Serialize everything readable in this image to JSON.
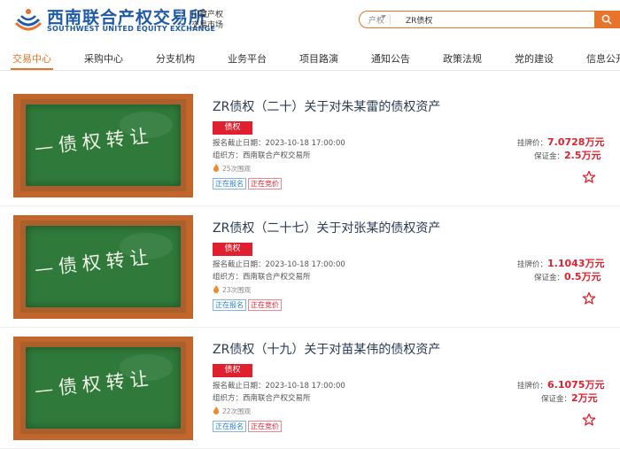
{
  "header": {
    "brand_cn": "西南联合产权交易所",
    "brand_en": "SOUTHWEST UNITED EQUITY EXCHANGE",
    "sub_brand_line1": "川藏产权",
    "sub_brand_line2": "交易市场"
  },
  "search": {
    "category": "产权",
    "value": "ZR债权"
  },
  "nav": {
    "items": [
      "交易中心",
      "采购中心",
      "分支机构",
      "业务平台",
      "项目路演",
      "通知公告",
      "政策法规",
      "党的建设",
      "信息公开"
    ],
    "active_index": 0
  },
  "listings": [
    {
      "thumbnail_text": "—债权转让",
      "title": "ZR债权（二十）关于对朱某雷的债权资产",
      "type": "债权",
      "deadline": "报名截止日期：2023-10-18 17:00:00",
      "organizer": "组织方：西南联合产权交易所",
      "views": "25次围观",
      "status_registering": "正在报名",
      "status_bidding": "正在竞价",
      "listing_price_label": "挂牌价：",
      "listing_price": "7.0728万元",
      "deposit_label": "保证金：",
      "deposit": "2.5万元"
    },
    {
      "thumbnail_text": "—债权转让",
      "title": "ZR债权（二十七）关于对张某的债权资产",
      "type": "债权",
      "deadline": "报名截止日期：2023-10-18 17:00:00",
      "organizer": "组织方：西南联合产权交易所",
      "views": "23次围观",
      "status_registering": "正在报名",
      "status_bidding": "正在竞价",
      "listing_price_label": "挂牌价：",
      "listing_price": "1.1043万元",
      "deposit_label": "保证金：",
      "deposit": "0.5万元"
    },
    {
      "thumbnail_text": "—债权转让",
      "title": "ZR债权（十九）关于对苗某伟的债权资产",
      "type": "债权",
      "deadline": "报名截止日期：2023-10-18 17:00:00",
      "organizer": "组织方：西南联合产权交易所",
      "views": "22次围观",
      "status_registering": "正在报名",
      "status_bidding": "正在竞价",
      "listing_price_label": "挂牌价：",
      "listing_price": "6.1075万元",
      "deposit_label": "保证金：",
      "deposit": "2万元"
    }
  ],
  "colors": {
    "brand_blue": "#1f5aa6",
    "accent_orange": "#e8732a",
    "price_red": "#e0202f",
    "status_blue": "#2a7fd2"
  }
}
